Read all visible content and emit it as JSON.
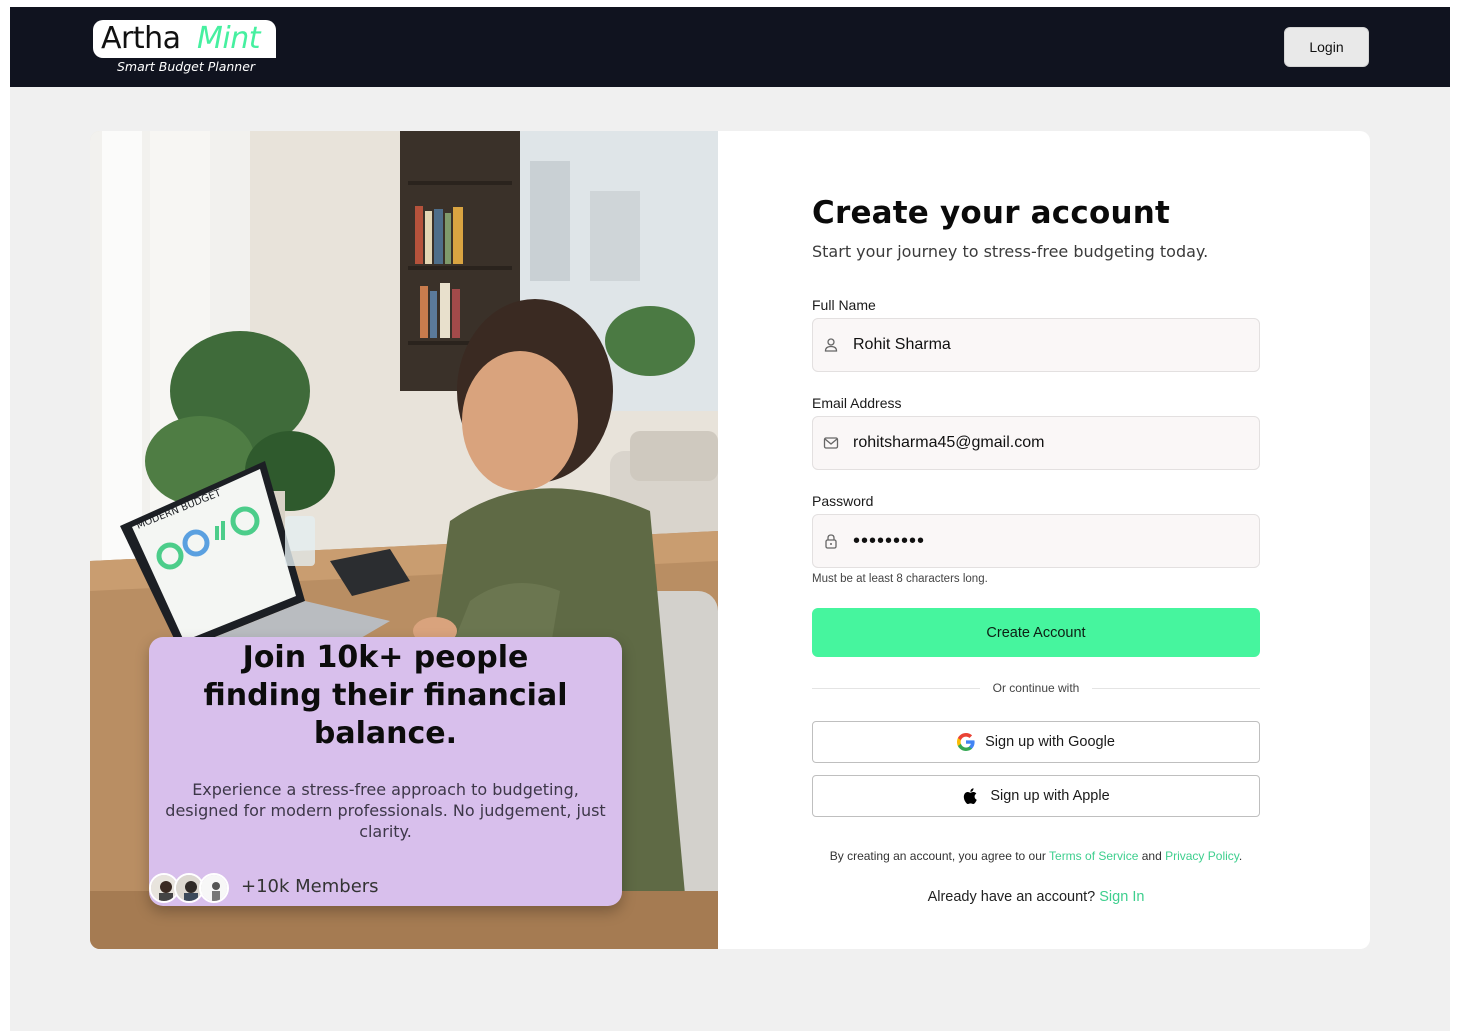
{
  "header": {
    "logo_part1": "Artha",
    "logo_part2": "Mint",
    "logo_tagline": "Smart Budget Planner",
    "login_label": "Login"
  },
  "hero": {
    "laptop_screen_text": "MODERN BUDGET",
    "promo_title": "Join 10k+ people finding their financial balance.",
    "promo_subtitle": "Experience a stress-free approach to budgeting, designed for modern professionals. No judgement, just clarity.",
    "members_label": "+10k Members"
  },
  "form": {
    "title": "Create your account",
    "subtitle": "Start your journey to stress-free budgeting today.",
    "full_name": {
      "label": "Full Name",
      "value": "Rohit Sharma",
      "icon": "user-icon"
    },
    "email": {
      "label": "Email Address",
      "value": "rohitsharma45@gmail.com",
      "icon": "mail-icon"
    },
    "password": {
      "label": "Password",
      "value": "password1",
      "icon": "lock-icon",
      "hint": "Must be at least 8 characters long."
    },
    "submit_label": "Create Account",
    "divider_text": "Or continue with",
    "google_label": "Sign up with Google",
    "apple_label": "Sign up with Apple",
    "terms_prefix": "By creating an account, you agree to our",
    "terms_link": "Terms of Service",
    "terms_and": "and",
    "privacy_link": "Privacy Policy",
    "terms_suffix": ".",
    "signin_prompt": "Already have an account?",
    "signin_link": "Sign In"
  },
  "colors": {
    "accent": "#46f59e",
    "link": "#3ecf8e",
    "header_bg": "#10131f",
    "promo_bg": "#d8bfec"
  }
}
